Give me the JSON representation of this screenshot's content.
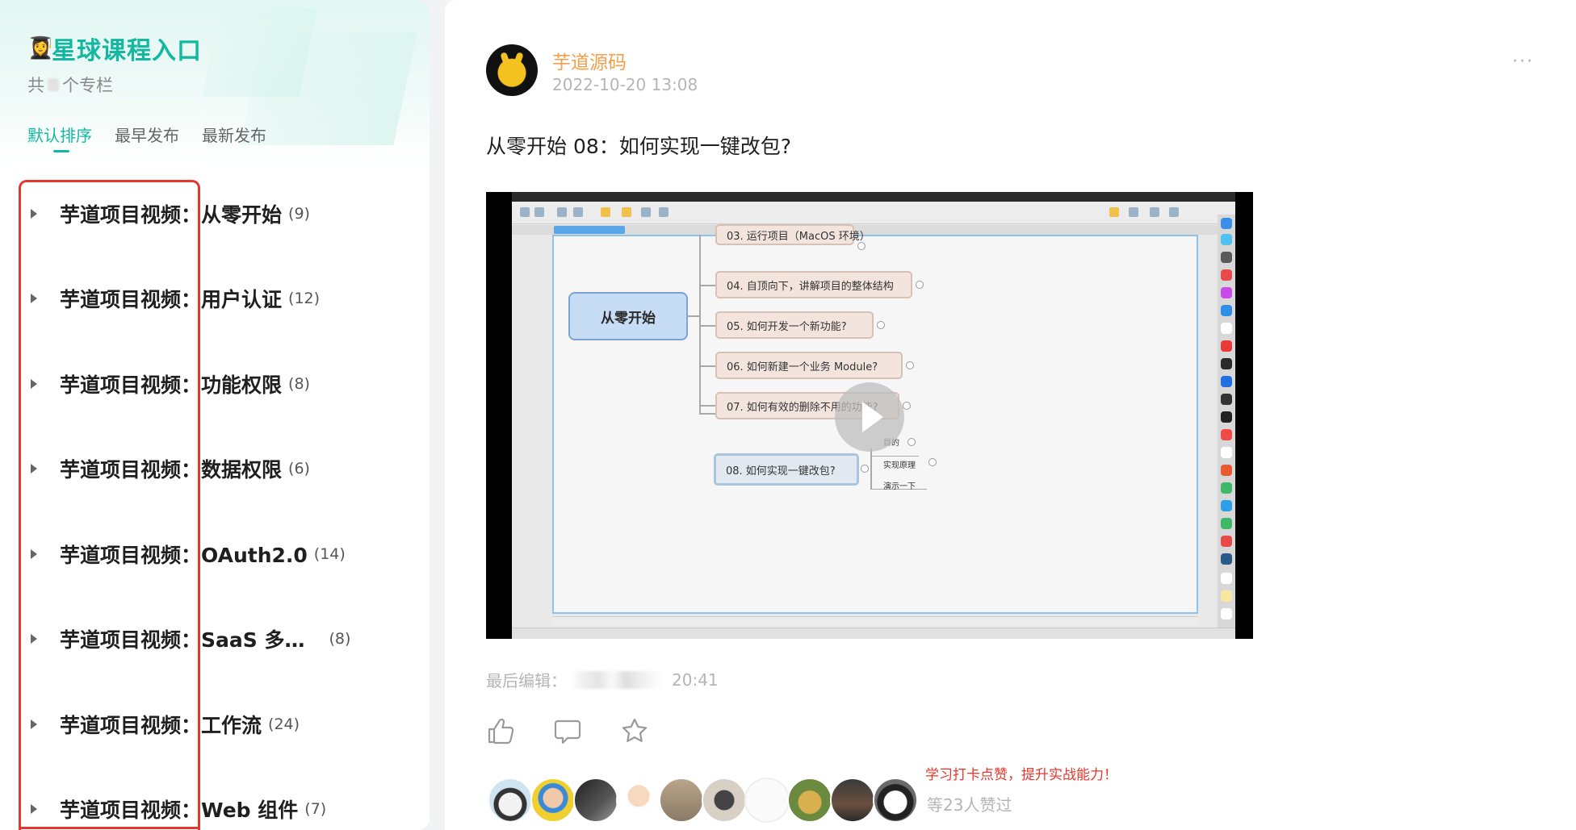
{
  "sidebar": {
    "title_emoji": "👩‍🎓",
    "title": "星球课程入口",
    "subtitle_prefix": "共",
    "subtitle_suffix": "个专栏",
    "tabs": [
      {
        "label": "默认排序",
        "active": true
      },
      {
        "label": "最早发布",
        "active": false
      },
      {
        "label": "最新发布",
        "active": false
      }
    ],
    "columns": [
      {
        "prefix": "芋道项目视频",
        "name": "从零开始",
        "count": "(9)"
      },
      {
        "prefix": "芋道项目视频",
        "name": "用户认证",
        "count": "(12)"
      },
      {
        "prefix": "芋道项目视频",
        "name": "功能权限",
        "count": "(8)"
      },
      {
        "prefix": "芋道项目视频",
        "name": "数据权限",
        "count": "(6)"
      },
      {
        "prefix": "芋道项目视频",
        "name": "OAuth2.0",
        "count": "(14)"
      },
      {
        "prefix": "芋道项目视频",
        "name": "SaaS 多…",
        "count": "(8)"
      },
      {
        "prefix": "芋道项目视频",
        "name": "工作流",
        "count": "(24)"
      },
      {
        "prefix": "芋道项目视频",
        "name": "Web 组件",
        "count": "(7)"
      }
    ],
    "colon": "："
  },
  "post": {
    "author": "芋道源码",
    "time": "2022-10-20 13:08",
    "more": "···",
    "title": "从零开始 08：如何实现一键改包?",
    "video": {
      "mindmap_root": "从零开始",
      "nodes": [
        "03. 运行项目（MacOS 环境）",
        "04. 自顶向下，讲解项目的整体结构",
        "05. 如何开发一个新功能?",
        "06. 如何新建一个业务 Module?",
        "07. 如何有效的删除不用的功能?",
        "08. 如何实现一键改包?"
      ],
      "sub_nodes": [
        "目的",
        "实现原理",
        "演示一下"
      ]
    },
    "edited_label": "最后编辑：",
    "edited_time": "20:41",
    "motto": "学习打卡点赞，提升实战能力！",
    "liked_count": "等23人赞过"
  },
  "colors": {
    "accent": "#14b8a0",
    "author": "#f0a04b",
    "annotation_red": "#e8362c",
    "muted": "#b5b5b5"
  },
  "icons": {
    "like": "thumbs-up-icon",
    "comment": "comment-icon",
    "favorite": "star-icon",
    "expand": "caret-right-icon",
    "play": "play-icon"
  }
}
